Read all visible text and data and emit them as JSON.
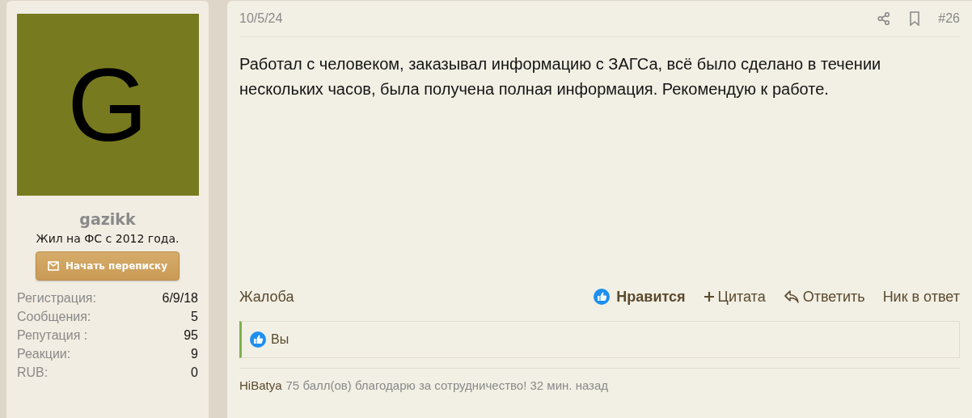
{
  "author": {
    "avatar": {
      "letter": "G",
      "color": "#787a1f"
    },
    "name": "gazikk",
    "title": "Жил на ФС с 2012 года.",
    "message_button": "Начать переписку",
    "stats": [
      {
        "label": "Регистрация:",
        "value": "6/9/18"
      },
      {
        "label": "Сообщения:",
        "value": "5"
      },
      {
        "label": "Репутация :",
        "value": "95"
      },
      {
        "label": "Реакции:",
        "value": "9"
      },
      {
        "label": "RUB:",
        "value": "0"
      }
    ]
  },
  "post": {
    "date": "10/5/24",
    "number": "#26",
    "text": "Работал с человеком, заказывал информацию с ЗАГСа, всё было сделано в течении нескольких часов, была получена полная информация. Рекомендую к работе.",
    "report": "Жалоба",
    "actions": [
      {
        "kind": "like",
        "label": "Нравится",
        "active": true
      },
      {
        "kind": "quote",
        "label": "Цитата",
        "active": false
      },
      {
        "kind": "reply",
        "label": "Ответить",
        "active": false
      },
      {
        "kind": "nick",
        "label": "Ник в ответ",
        "active": false
      }
    ],
    "reactions": "Вы",
    "reputation": {
      "user": "HiBatya",
      "text": "75 балл(ов) благодарю за сотрудничество! 32 мин. назад"
    }
  }
}
